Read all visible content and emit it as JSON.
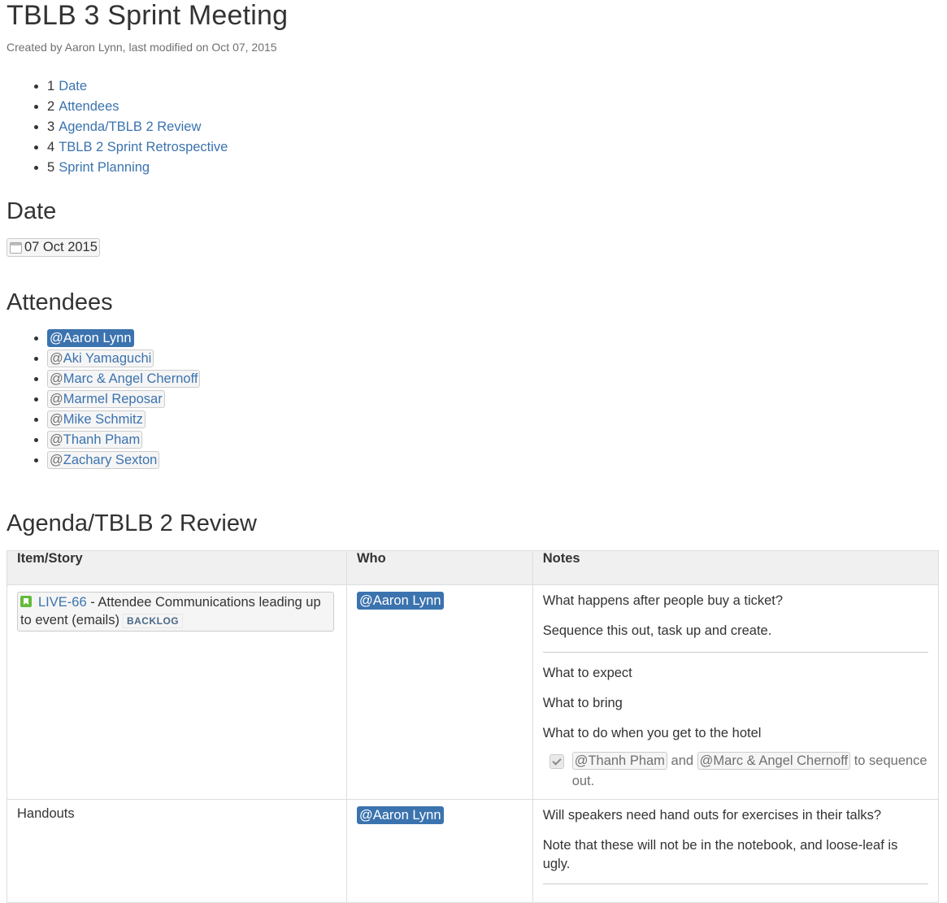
{
  "page": {
    "title": "TBLB 3 Sprint Meeting",
    "byline": "Created by Aaron Lynn, last modified on Oct 07, 2015"
  },
  "toc": [
    {
      "num": "1",
      "label": "Date"
    },
    {
      "num": "2",
      "label": "Attendees"
    },
    {
      "num": "3",
      "label": "Agenda/TBLB 2 Review"
    },
    {
      "num": "4",
      "label": "TBLB 2 Sprint Retrospective"
    },
    {
      "num": "5",
      "label": "Sprint Planning"
    }
  ],
  "date_section": {
    "heading": "Date",
    "date_value": "07 Oct 2015",
    "icon": "calendar-icon"
  },
  "attendees_section": {
    "heading": "Attendees",
    "at": "@",
    "people": [
      "Aaron Lynn",
      "Aki Yamaguchi",
      "Marc & Angel Chernoff",
      "Marmel Reposar",
      "Mike Schmitz",
      "Thanh Pham",
      "Zachary Sexton"
    ]
  },
  "agenda_section": {
    "heading": "Agenda/TBLB 2 Review",
    "columns": [
      "Item/Story",
      "Who",
      "Notes"
    ],
    "row1": {
      "issue_key": "LIVE-66",
      "issue_summary": " - Attendee Communications leading up to event (emails)",
      "status": "BACKLOG",
      "who": "Aaron Lynn",
      "notes": [
        "What happens after people buy a ticket?",
        "Sequence this out, task up and create.",
        "What to expect",
        "What to bring",
        "What to do when you get to the hotel"
      ],
      "task": {
        "mention1": "Thanh Pham",
        "and": "and",
        "mention2": "Marc & Angel Chernoff",
        "suffix": "to sequence out."
      }
    },
    "row2": {
      "item": "Handouts",
      "who": "Aaron Lynn",
      "notes": [
        "Will speakers need hand outs for exercises in their talks?",
        "Note that these will not be in the notebook, and loose-leaf is ugly."
      ]
    }
  },
  "colors": {
    "link": "#3b73af",
    "current_user_mention": "#3b73af",
    "story_icon": "#63ba3c",
    "status_text": "#4a6785",
    "logo_accent": "#e8581d"
  }
}
